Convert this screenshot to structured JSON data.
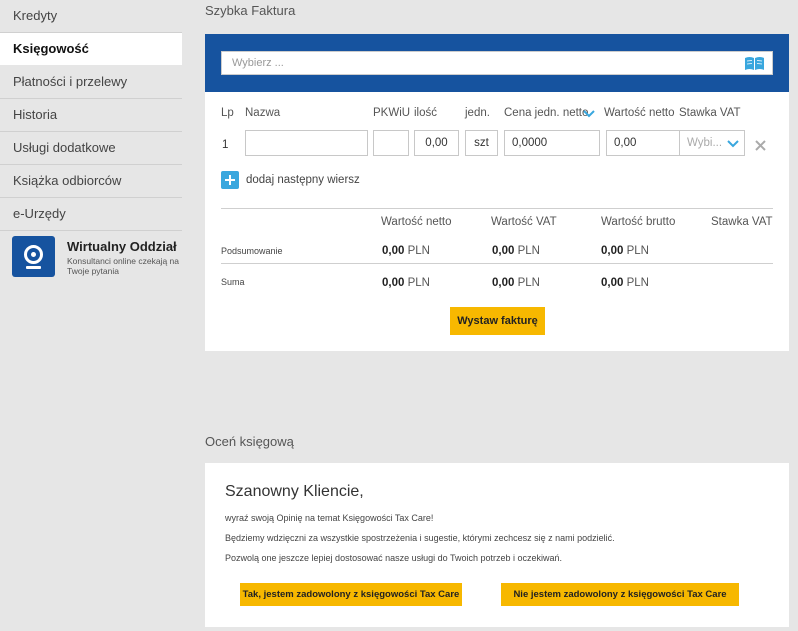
{
  "sidebar": {
    "items": [
      {
        "label": "Kredyty"
      },
      {
        "label": "Księgowość"
      },
      {
        "label": "Płatności i przelewy"
      },
      {
        "label": "Historia"
      },
      {
        "label": "Usługi dodatkowe"
      },
      {
        "label": "Książka odbiorców"
      },
      {
        "label": "e-Urzędy"
      }
    ],
    "active_index": 1,
    "virtual_office": {
      "title": "Wirtualny Oddział",
      "subtitle": "Konsultanci online czekają na Twoje pytania"
    }
  },
  "invoice": {
    "section_title": "Szybka Faktura",
    "search_placeholder": "Wybierz ...",
    "headers": {
      "lp": "Lp",
      "name": "Nazwa",
      "pkwiu": "PKWiU",
      "qty": "ilość",
      "unit": "jedn.",
      "unit_price": "Cena jedn. netto",
      "net_value": "Wartość netto",
      "vat_rate": "Stawka VAT"
    },
    "row": {
      "lp": "1",
      "name": "",
      "pkwiu": "",
      "qty": "0,00",
      "unit": "szt",
      "unit_price": "0,0000",
      "net_value": "0,00",
      "vat_placeholder": "Wybi..."
    },
    "add_row_label": "dodaj następny wiersz",
    "summary": {
      "headers": {
        "net": "Wartość netto",
        "vat": "Wartość VAT",
        "gross": "Wartość brutto",
        "rate": "Stawka VAT"
      },
      "rows": [
        {
          "label": "Podsumowanie",
          "net": "0,00",
          "vat": "0,00",
          "gross": "0,00"
        },
        {
          "label": "Suma",
          "net": "0,00",
          "vat": "0,00",
          "gross": "0,00"
        }
      ],
      "currency": "PLN"
    },
    "submit_label": "Wystaw fakturę"
  },
  "rating": {
    "section_title": "Oceń księgową",
    "greeting": "Szanowny Kliencie,",
    "lines": [
      "wyraź swoją Opinię na temat Księgowości Tax Care!",
      "Będziemy wdzięczni za wszystkie spostrzeżenia i sugestie, którymi zechcesz się z nami podzielić.",
      "Pozwolą one jeszcze lepiej dostosować nasze usługi do Twoich potrzeb i oczekiwań."
    ],
    "yes_label": "Tak, jestem zadowolony z księgowości Tax Care",
    "no_label": "Nie jestem zadowolony z księgowości Tax Care"
  },
  "colors": {
    "brand_blue": "#16539f",
    "accent_cyan": "#39a7de",
    "button_yellow": "#f7b800"
  }
}
